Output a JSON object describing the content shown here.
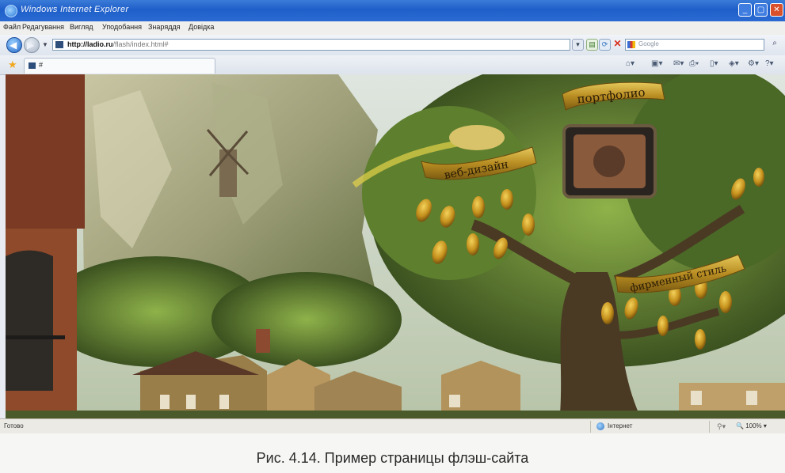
{
  "window": {
    "title": "Windows Internet Explorer",
    "controls": {
      "minimize": "_",
      "maximize": "▢",
      "close": "✕"
    }
  },
  "menu": {
    "items": [
      "Файл",
      "Редагування",
      "Вигляд",
      "Уподобання",
      "Знаряддя",
      "Довідка"
    ]
  },
  "address": {
    "url_host": "http://ladio.ru",
    "url_path": "/flash/index.html#"
  },
  "search": {
    "placeholder": "Google"
  },
  "tab": {
    "label": "#"
  },
  "content": {
    "banners": [
      "портфолио",
      "веб-дизайн",
      "фирменный стиль"
    ]
  },
  "status": {
    "text": "Готово",
    "zone": "Інтернет",
    "zoom": "100%"
  },
  "caption": "Рис. 4.14. Пример страницы флэш-сайта",
  "colors": {
    "title_bar": "#2a6ad2",
    "close_button": "#d9512c",
    "banner_gold": "#c9a52e",
    "foliage": "#4f6a2c"
  }
}
